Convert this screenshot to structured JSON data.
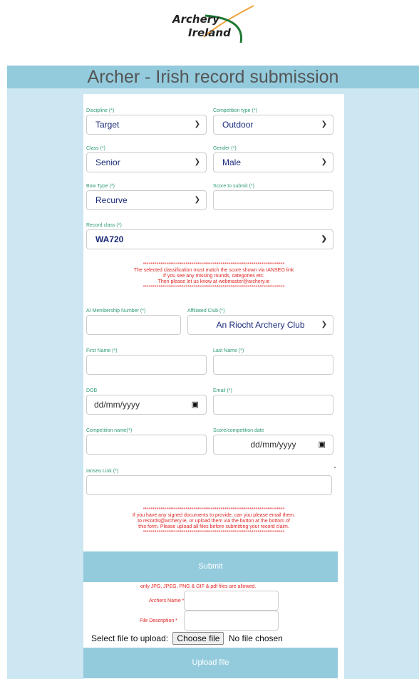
{
  "logo": {
    "line1": "Archery",
    "line2": "Ireland"
  },
  "title": "Archer - Irish record submission",
  "discipline": {
    "label": "Discipline (*)",
    "value": "Target"
  },
  "competition_type": {
    "label": "Competition type (*)",
    "value": "Outdoor"
  },
  "class": {
    "label": "Class (*)",
    "value": "Senior"
  },
  "gender": {
    "label": "Gender (*)",
    "value": "Male"
  },
  "bow_type": {
    "label": "Bow Type (*)",
    "value": "Recurve"
  },
  "score": {
    "label": "Score to submit (*)"
  },
  "record_class": {
    "label": "Record class (*)",
    "value": "WA720"
  },
  "notice1": {
    "stars": "*************************************************************************",
    "line1": "The selected classification must match the score shown via IANSEO link",
    "line2": "If you see any missing rounds, categories etc.",
    "line3": "Then please let us know at webmaster@archery.ie",
    "stars2": "*************************************************************************"
  },
  "membership": {
    "label": "AI Membership Number (*)"
  },
  "club": {
    "label": "Affiliated Club (*)",
    "value": "An Riocht Archery Club"
  },
  "first_name": {
    "label": "First Name (*)"
  },
  "last_name": {
    "label": "Last Name (*)"
  },
  "dob": {
    "label": "DOB",
    "placeholder": "dd/mm/yyyy"
  },
  "email": {
    "label": "Email (*)"
  },
  "competition_name": {
    "label": "Competition name(*)"
  },
  "score_date": {
    "label": "Score/competition date",
    "placeholder": "dd/mm/yyyy"
  },
  "ianseo": {
    "label": "Ianseo Link (*)"
  },
  "notice2": {
    "stars": "*************************************************************************",
    "line1": "If you have any signed documents to provide, can you please email them.",
    "line2": "to records@archery.ie, or upload them via the button at the bottom of",
    "line3": "this form. Please upload all files before submitting your record claim.",
    "stars2": "*************************************************************************"
  },
  "submit_label": "Submit",
  "upload": {
    "allowed": "only JPG, JPEG, PNG & GIF & pdf files are allowed.",
    "archers_name_label": "Archers Name *",
    "file_description_label": "File Description *",
    "select_label": "Select file to upload:",
    "choose_label": "Choose file",
    "no_file": "No file chosen",
    "upload_label": "Upload file"
  },
  "colors": {
    "accent": "#93cbdd",
    "side": "#cce6f2",
    "label": "#2e9a78",
    "warning": "#e02424",
    "value": "#1a2a7a"
  }
}
